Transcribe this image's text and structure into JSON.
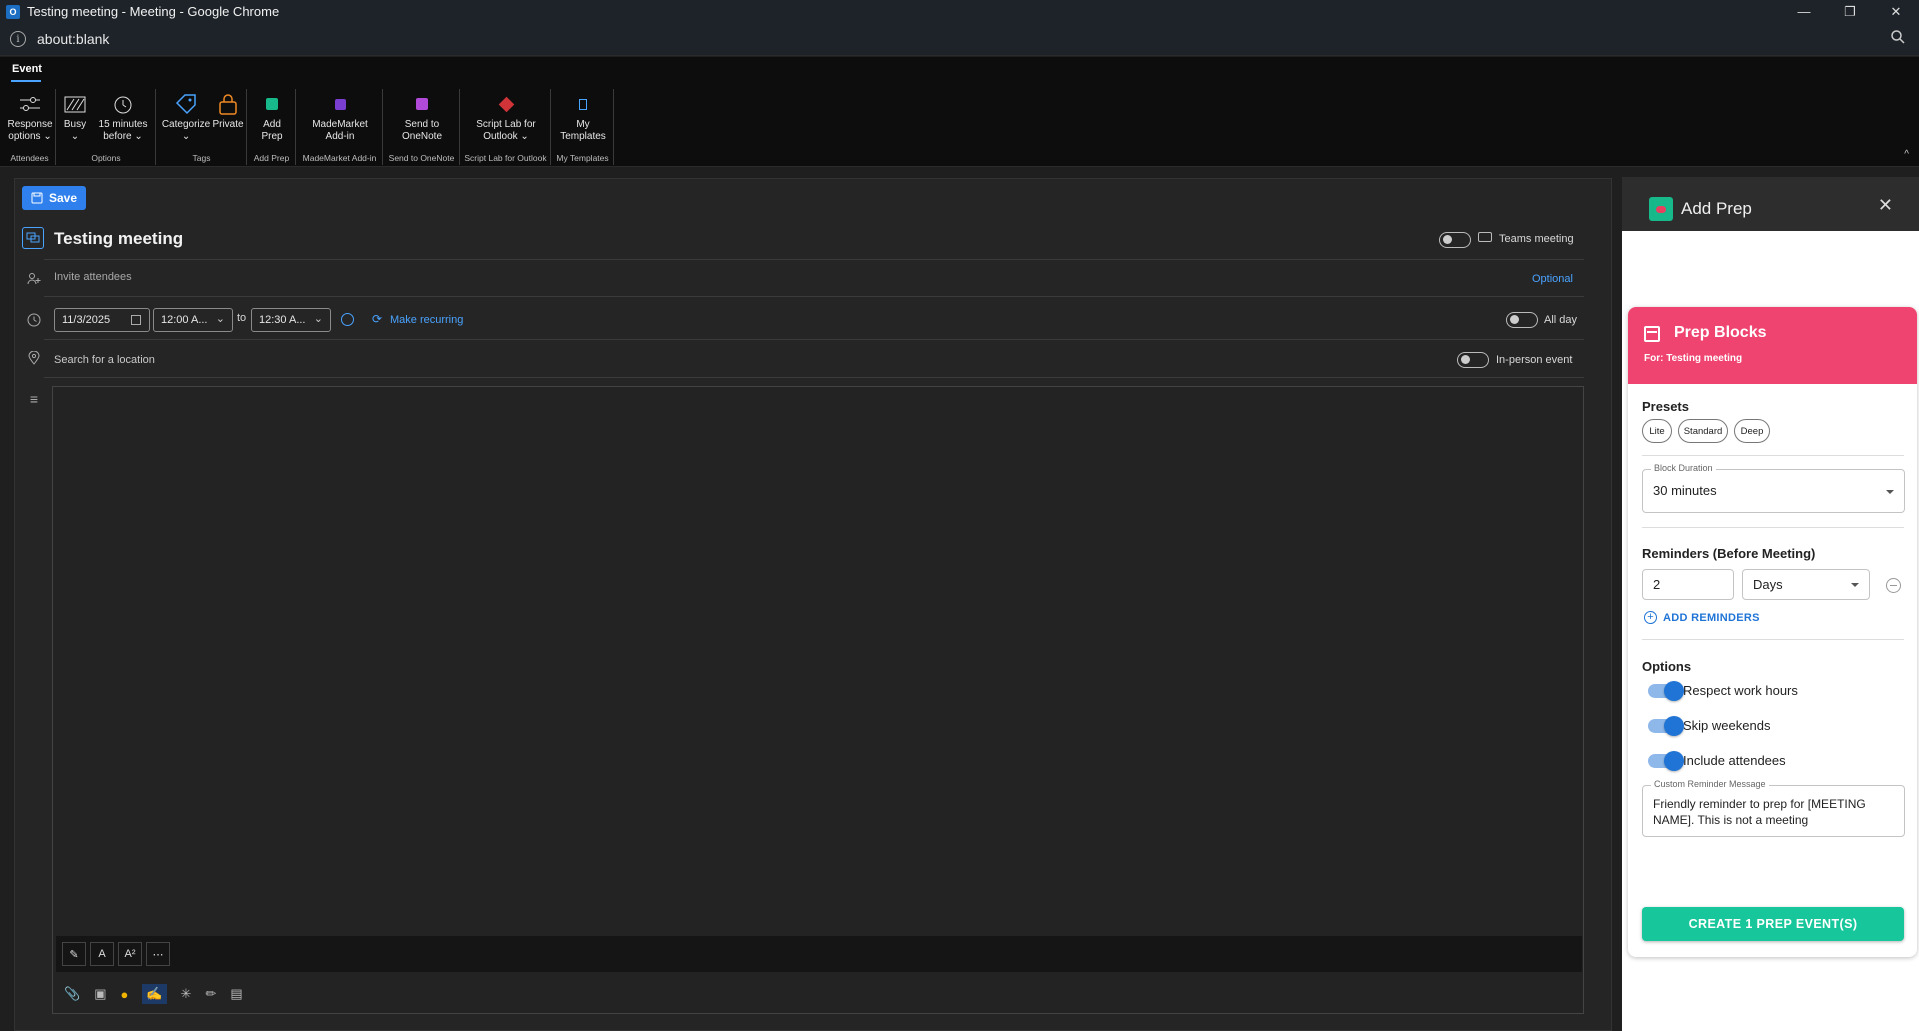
{
  "window": {
    "title": "Testing meeting - Meeting - Google Chrome",
    "app_icon": "O",
    "minimize": "—",
    "restore": "❐",
    "close": "✕"
  },
  "address": {
    "url": "about:blank"
  },
  "ribbon": {
    "tab": "Event",
    "groups": [
      {
        "label": "Attendees",
        "buttons": [
          {
            "label": "Response options ⌄",
            "icon": "sliders-icon"
          }
        ]
      },
      {
        "label": "Options",
        "buttons": [
          {
            "label": "Busy ⌄",
            "icon": "busy-icon"
          },
          {
            "label": "15 minutes before ⌄",
            "icon": "alarm-icon"
          }
        ]
      },
      {
        "label": "Tags",
        "buttons": [
          {
            "label": "Categorize ⌄",
            "icon": "tag-icon"
          },
          {
            "label": "Private",
            "icon": "lock-icon"
          }
        ]
      },
      {
        "label": "Add Prep",
        "buttons": [
          {
            "label": "Add Prep",
            "icon": "add-prep-icon"
          }
        ]
      },
      {
        "label": "MadeMarket Add-in",
        "buttons": [
          {
            "label": "MadeMarket Add-in",
            "icon": "mademarket-icon"
          }
        ]
      },
      {
        "label": "Send to OneNote",
        "buttons": [
          {
            "label": "Send to OneNote",
            "icon": "onenote-icon"
          }
        ]
      },
      {
        "label": "Script Lab for Outlook",
        "buttons": [
          {
            "label": "Script Lab for Outlook ⌄",
            "icon": "scriptlab-icon"
          }
        ]
      },
      {
        "label": "My Templates",
        "buttons": [
          {
            "label": "My Templates",
            "icon": "templates-icon"
          }
        ]
      }
    ]
  },
  "editor": {
    "save": "Save",
    "title": "Testing meeting",
    "teams": "Teams meeting",
    "invite_placeholder": "Invite attendees",
    "optional": "Optional",
    "start_date": "11/3/2025",
    "start_time": "12:00 A...",
    "to": "to",
    "end_time": "12:30 A...",
    "make_recurring": "Make recurring",
    "all_day": "All day",
    "location_placeholder": "Search for a location",
    "in_person": "In-person event"
  },
  "panel": {
    "title": "Add Prep",
    "card_title": "Prep Blocks",
    "card_subtitle": "For: Testing meeting",
    "presets_label": "Presets",
    "presets": [
      "Lite",
      "Standard",
      "Deep"
    ],
    "block_duration_label": "Block Duration",
    "block_duration": "30 minutes",
    "reminders_label": "Reminders (Before Meeting)",
    "reminder_value": "2",
    "reminder_unit": "Days",
    "add_reminders": "ADD REMINDERS",
    "options_label": "Options",
    "options": [
      "Respect work hours",
      "Skip weekends",
      "Include attendees"
    ],
    "custom_message_label": "Custom Reminder Message",
    "custom_message": "Friendly reminder to prep for [MEETING NAME]. This is not a meeting",
    "create_button": "CREATE 1 PREP EVENT(S)"
  },
  "colors": {
    "accent": "#2f80ed",
    "prep_header": "#ef4470",
    "create": "#17c79b",
    "switch": "#1f74d6"
  }
}
